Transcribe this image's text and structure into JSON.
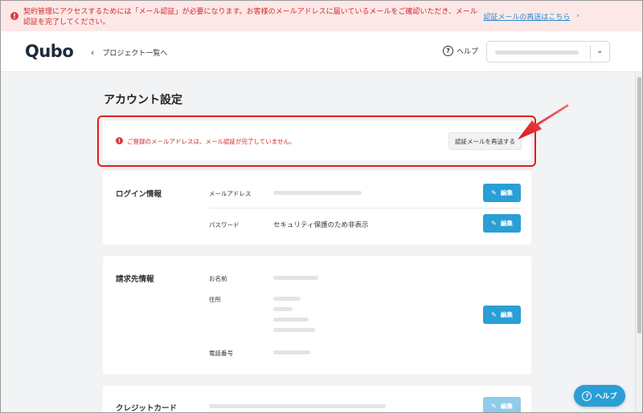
{
  "banner": {
    "icon": "alert-circle-icon",
    "message": "契約管理にアクセスするためには「メール認証」が必要になります。お客様のメールアドレスに届いているメールをご確認いただき、メール認証を完了してください。",
    "link_label": "認証メールの再送はこちら",
    "color": "#d02828"
  },
  "header": {
    "logo": "Qubo",
    "back_label": "プロジェクト一覧へ",
    "help_label": "ヘルプ"
  },
  "page": {
    "title": "アカウント設定"
  },
  "warning": {
    "message": "ご登録のメールアドレスは、メール認証が完了していません。",
    "resend_button": "認証メールを再送する"
  },
  "login_info": {
    "title": "ログイン情報",
    "email_label": "メールアドレス",
    "password_label": "パスワード",
    "password_value": "セキュリティ保護のため非表示",
    "edit_label": "編集"
  },
  "billing_info": {
    "title": "請求先情報",
    "name_label": "お名前",
    "address_label": "住所",
    "phone_label": "電話番号",
    "edit_label": "編集"
  },
  "credit_card": {
    "title": "クレジットカード",
    "edit_label": "編集"
  },
  "help_float": {
    "label": "ヘルプ"
  },
  "colors": {
    "accent": "#2a9fd6",
    "highlight": "#e21d1d"
  }
}
